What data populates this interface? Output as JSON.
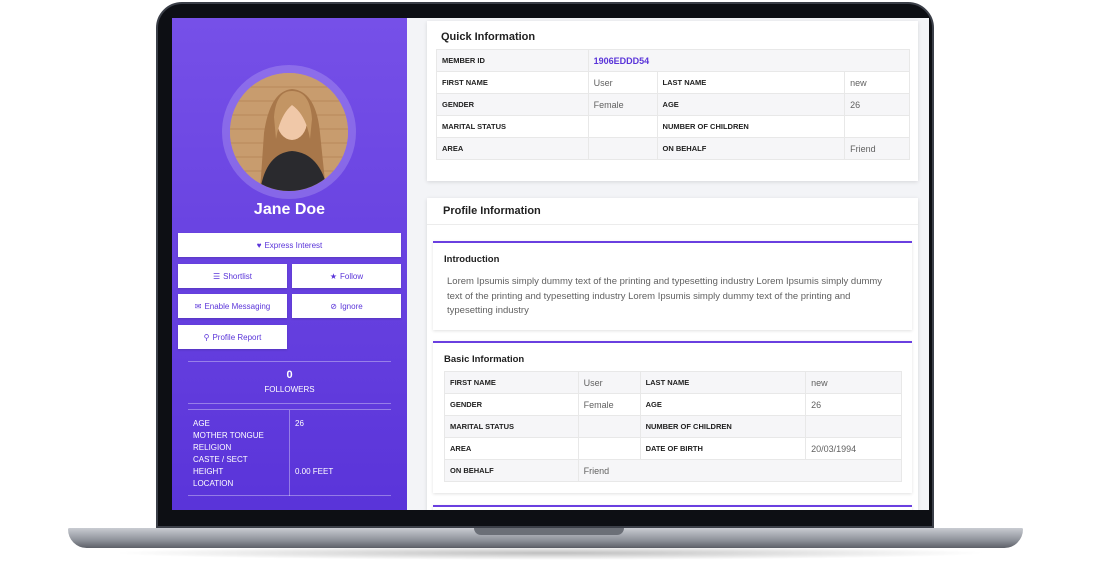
{
  "profile": {
    "name": "Jane Doe",
    "buttons": {
      "express_interest": "Express Interest",
      "shortlist": "Shortlist",
      "follow": "Follow",
      "enable_messaging": "Enable Messaging",
      "ignore": "Ignore",
      "profile_report": "Profile Report"
    },
    "followers_count": "0",
    "followers_label": "FOLLOWERS",
    "facts": [
      {
        "label": "AGE",
        "value": "26"
      },
      {
        "label": "MOTHER TONGUE",
        "value": ""
      },
      {
        "label": "RELIGION",
        "value": ""
      },
      {
        "label": "CASTE / SECT",
        "value": ""
      },
      {
        "label": "HEIGHT",
        "value": "0.00 FEET"
      },
      {
        "label": "LOCATION",
        "value": ""
      }
    ]
  },
  "quick_info": {
    "title": "Quick Information",
    "member_id_label": "MEMBER ID",
    "member_id": "1906EDDD54",
    "first_name_label": "FIRST NAME",
    "first_name": "User",
    "last_name_label": "LAST NAME",
    "last_name": "new",
    "gender_label": "GENDER",
    "gender": "Female",
    "age_label": "AGE",
    "age": "26",
    "marital_label": "MARITAL STATUS",
    "marital": "",
    "children_label": "NUMBER OF CHILDREN",
    "children": "",
    "area_label": "AREA",
    "area": "",
    "behalf_label": "ON BEHALF",
    "behalf": "Friend"
  },
  "profile_info": {
    "title": "Profile Information",
    "intro_title": "Introduction",
    "intro_text": "Lorem Ipsumis simply dummy text of the printing and typesetting industry Lorem Ipsumis simply dummy text of the printing and typesetting industry Lorem Ipsumis simply dummy text of the printing and typesetting industry",
    "basic_title": "Basic Information",
    "basic": {
      "first_name_label": "FIRST NAME",
      "first_name": "User",
      "last_name_label": "LAST NAME",
      "last_name": "new",
      "gender_label": "GENDER",
      "gender": "Female",
      "age_label": "AGE",
      "age": "26",
      "marital_label": "MARITAL STATUS",
      "marital": "",
      "children_label": "NUMBER OF CHILDREN",
      "children": "",
      "area_label": "AREA",
      "area": "",
      "dob_label": "DATE OF BIRTH",
      "dob": "20/03/1994",
      "behalf_label": "ON BEHALF",
      "behalf": "Friend"
    }
  },
  "colors": {
    "accent": "#5a34d9",
    "panel_top": "#7650e8",
    "panel_bottom": "#5a34d9"
  },
  "icons": {
    "express_interest": "heart-icon",
    "shortlist": "list-icon",
    "follow": "star-icon",
    "enable_messaging": "chat-icon",
    "ignore": "ban-icon",
    "profile_report": "ribbon-icon"
  }
}
